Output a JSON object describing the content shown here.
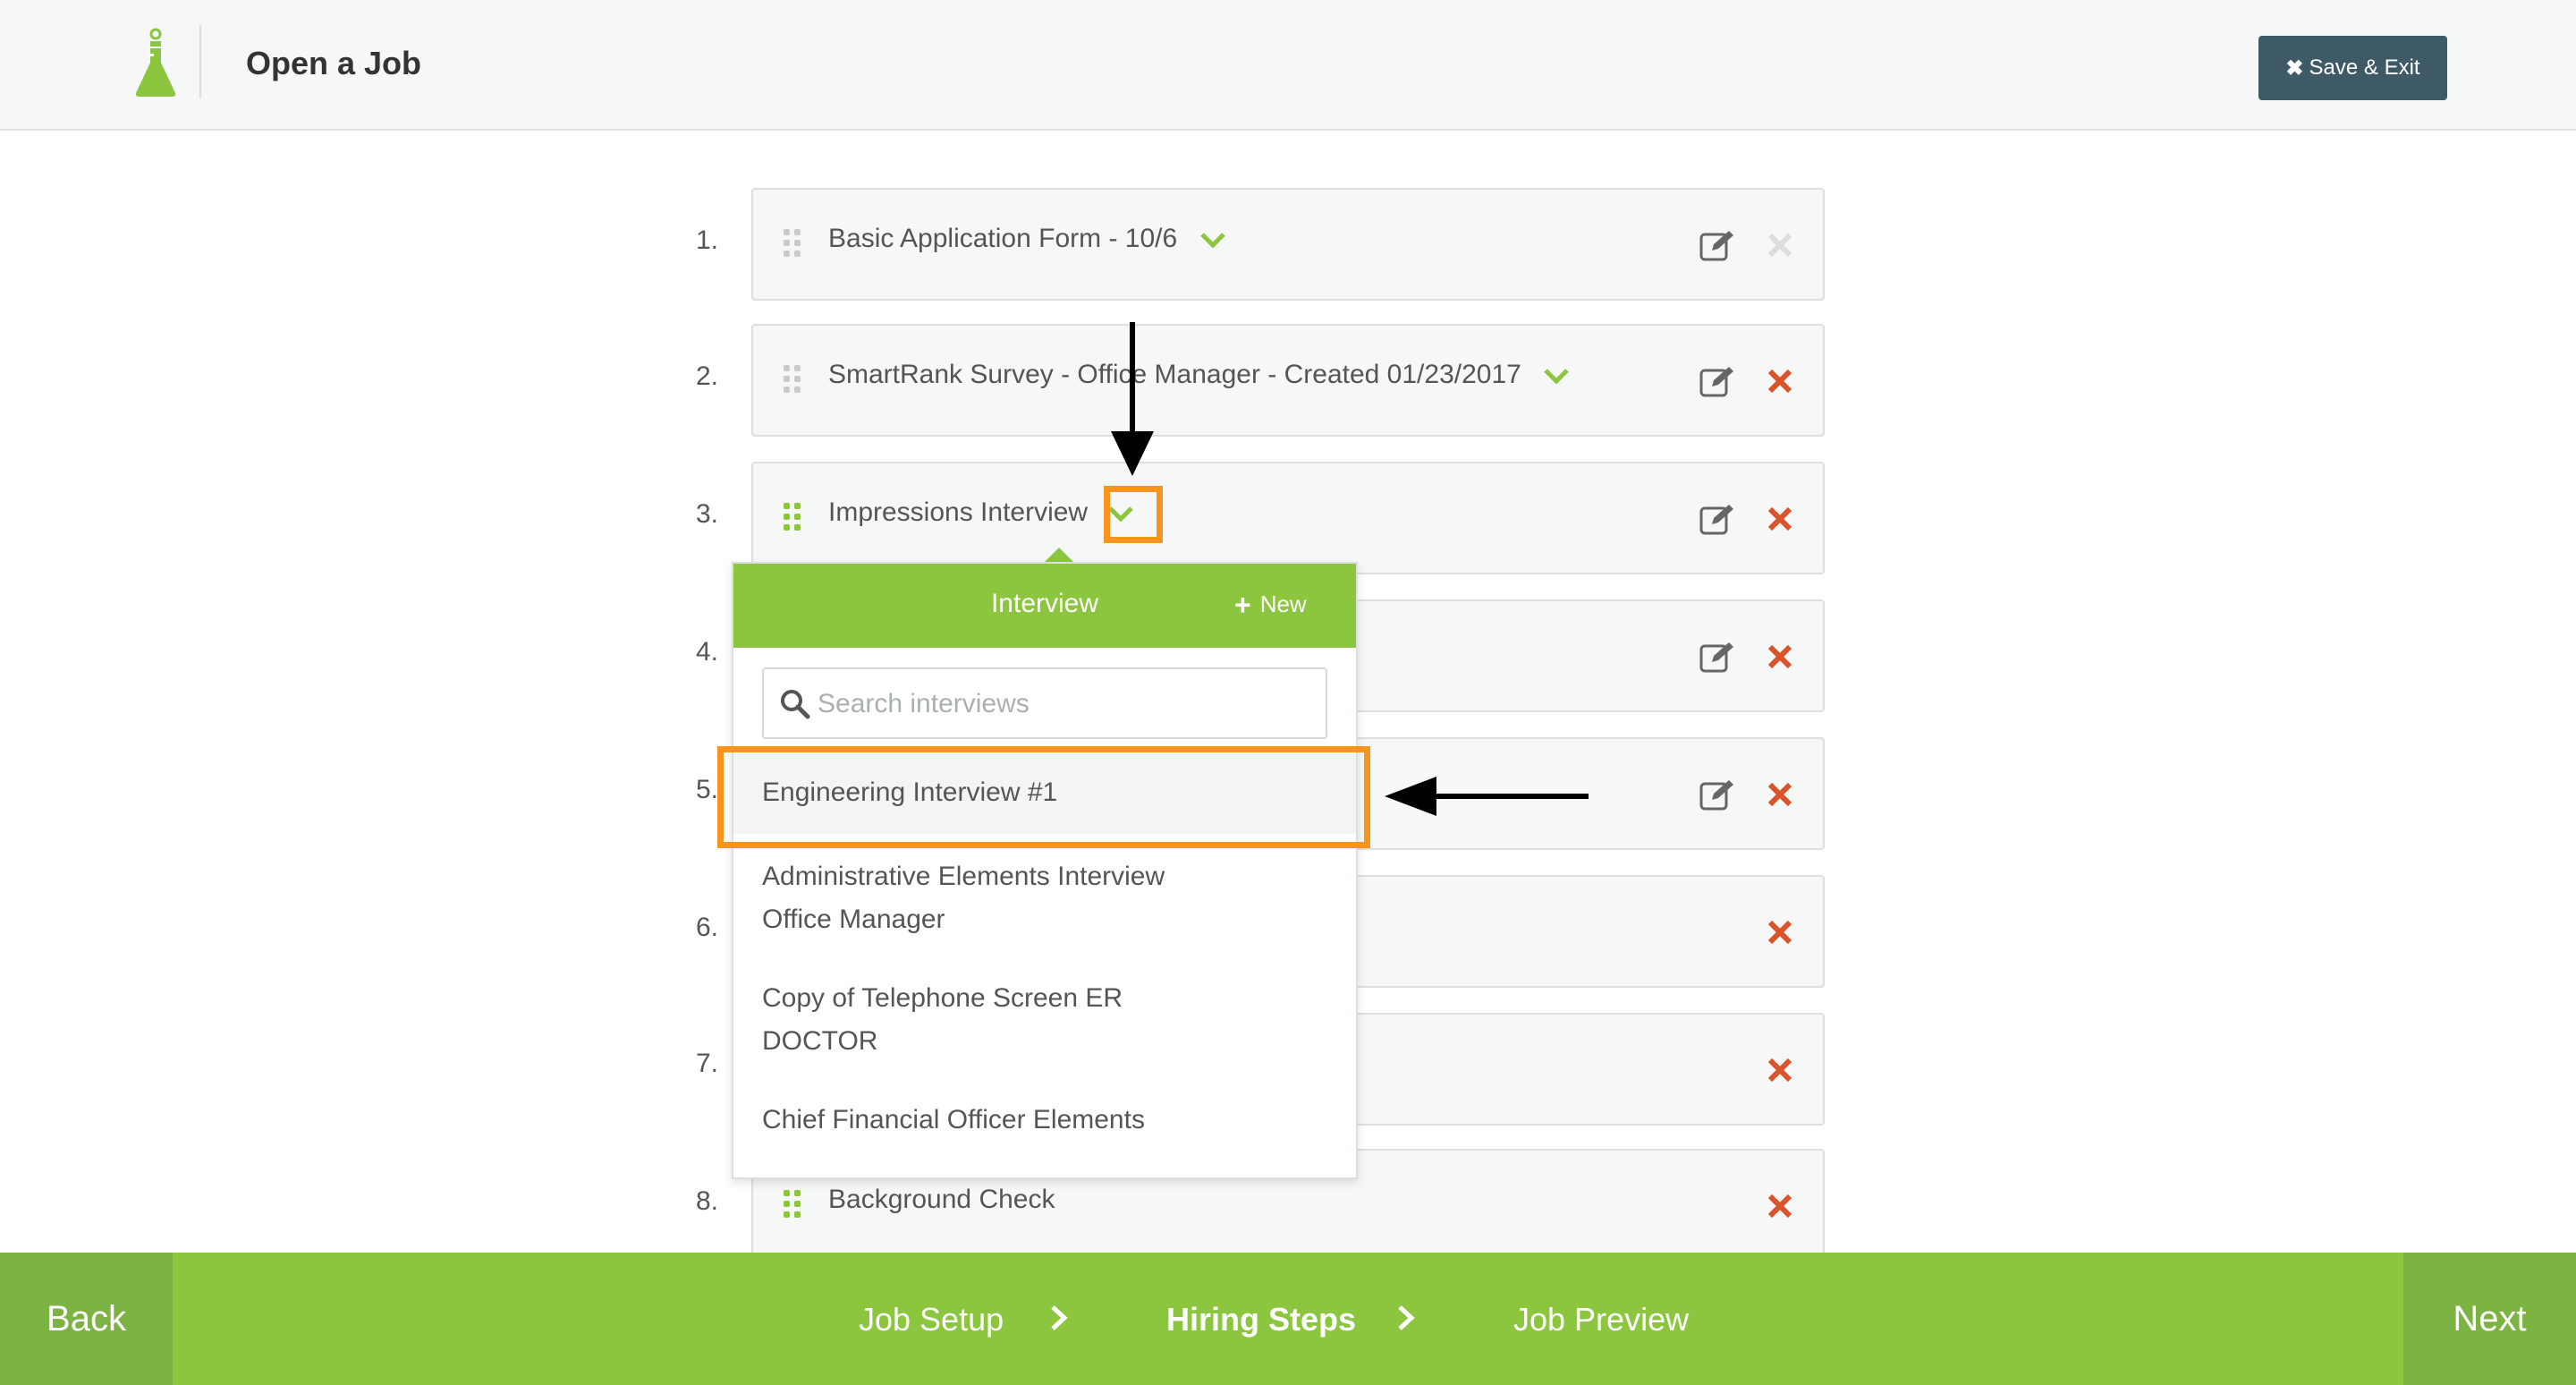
{
  "header": {
    "title": "Open a Job",
    "save_exit_label": "Save & Exit"
  },
  "steps": [
    {
      "number": "1.",
      "label": "Basic Application Form - 10/6"
    },
    {
      "number": "2.",
      "label": "SmartRank Survey - Office Manager - Created 01/23/2017"
    },
    {
      "number": "3.",
      "label": "Impressions Interview"
    },
    {
      "number": "4.",
      "label": ""
    },
    {
      "number": "5.",
      "label": ""
    },
    {
      "number": "6.",
      "label": ""
    },
    {
      "number": "7.",
      "label": ""
    },
    {
      "number": "8.",
      "label": "Background Check"
    }
  ],
  "dropdown": {
    "title": "Interview",
    "new_label": "New",
    "search_placeholder": "Search interviews",
    "items": [
      {
        "line1": "Engineering Interview #1",
        "line2": ""
      },
      {
        "line1": "Administrative Elements Interview",
        "line2": "Office Manager"
      },
      {
        "line1": "Copy of Telephone Screen ER",
        "line2": "DOCTOR"
      },
      {
        "line1": "Chief Financial Officer Elements",
        "line2": ""
      }
    ]
  },
  "footer": {
    "back_label": "Back",
    "next_label": "Next",
    "crumbs": [
      "Job Setup",
      "Hiring Steps",
      "Job Preview"
    ],
    "active_crumb": "Hiring Steps"
  },
  "colors": {
    "brand_green": "#8cc63f",
    "dark_green": "#7cb342",
    "delete_red": "#d9532b",
    "annotation_orange": "#f7941d",
    "button_slate": "#3e5a66"
  },
  "icons": {
    "logo": "flask-icon",
    "drag": "drag-handle-icon",
    "check": "chevron-down-icon",
    "edit": "edit-icon",
    "delete": "close-icon",
    "search": "search-icon"
  }
}
